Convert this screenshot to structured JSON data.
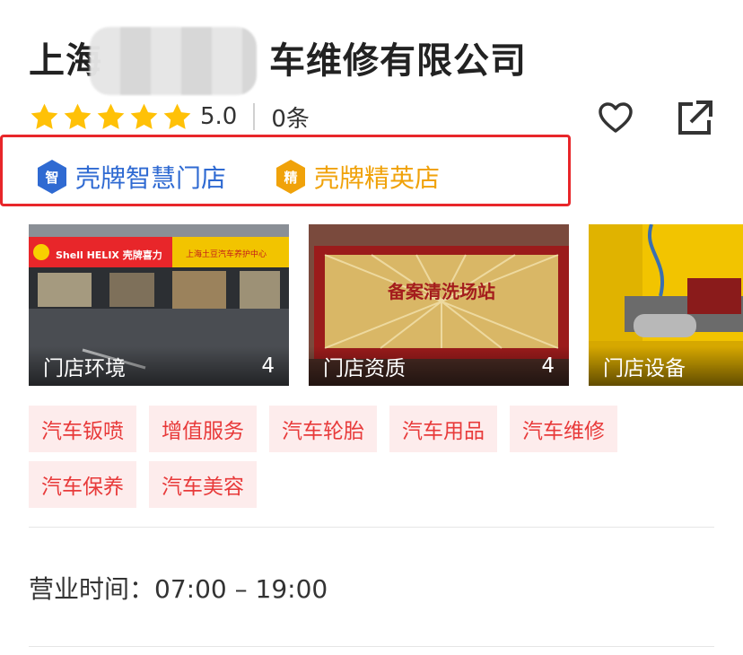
{
  "shop": {
    "name_prefix": "上海",
    "name_suffix": "车维修有限公司",
    "rating": "5.0",
    "review_count": "0条",
    "stars": 5
  },
  "badges": [
    {
      "icon_char": "智",
      "label": "壳牌智慧门店",
      "color": "#2f6ad2"
    },
    {
      "icon_char": "精",
      "label": "壳牌精英店",
      "color": "#f0a20a"
    }
  ],
  "photos": [
    {
      "label": "门店环境",
      "count": "4",
      "shop_text": "Shell HELIX 壳牌喜力",
      "sign_text": "上海土豆汽车养护中心"
    },
    {
      "label": "门店资质",
      "count": "4",
      "plaque_text": "备案清洗场站"
    },
    {
      "label": "门店设备",
      "count": ""
    }
  ],
  "tags": [
    "汽车钣喷",
    "增值服务",
    "汽车轮胎",
    "汽车用品",
    "汽车维修",
    "汽车保养",
    "汽车美容"
  ],
  "hours": {
    "label": "营业时间：",
    "value": "07:00 – 19:00"
  },
  "colors": {
    "star": "#ffc107",
    "tag_bg": "#fdecec",
    "tag_text": "#e83a3a",
    "highlight_border": "#e8262a"
  },
  "icons": {
    "favorite": "heart-outline-icon",
    "share": "share-external-icon"
  }
}
